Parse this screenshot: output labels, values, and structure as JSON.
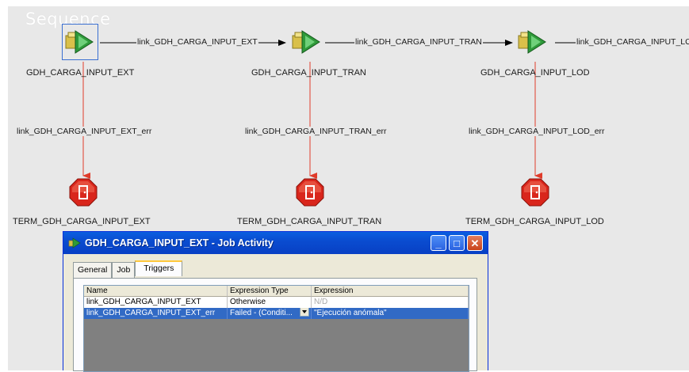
{
  "canvas": {
    "title": "Sequence"
  },
  "stages": [
    {
      "label": "GDH_CARGA_INPUT_EXT",
      "icon": "job-activity-icon",
      "selected": true
    },
    {
      "label": "GDH_CARGA_INPUT_TRAN",
      "icon": "job-activity-icon",
      "selected": false
    },
    {
      "label": "GDH_CARGA_INPUT_LOD",
      "icon": "job-activity-icon",
      "selected": false
    }
  ],
  "links": [
    "link_GDH_CARGA_INPUT_EXT",
    "link_GDH_CARGA_INPUT_TRAN",
    "link_GDH_CARGA_INPUT_LO"
  ],
  "error_links": [
    "link_GDH_CARGA_INPUT_EXT_err",
    "link_GDH_CARGA_INPUT_TRAN_err",
    "link_GDH_CARGA_INPUT_LOD_err"
  ],
  "terminators": [
    {
      "label": "TERM_GDH_CARGA_INPUT_EXT",
      "icon": "terminator-stop-icon"
    },
    {
      "label": "TERM_GDH_CARGA_INPUT_TRAN",
      "icon": "terminator-stop-icon"
    },
    {
      "label": "TERM_GDH_CARGA_INPUT_LOD",
      "icon": "terminator-stop-icon"
    }
  ],
  "dialog": {
    "title": "GDH_CARGA_INPUT_EXT - Job Activity",
    "buttons": {
      "minimize": "_",
      "maximize": "□",
      "close": "✕"
    },
    "tabs": [
      "General",
      "Job",
      "Triggers"
    ],
    "active_tab": "Triggers",
    "triggers_table": {
      "columns": [
        "Name",
        "Expression Type",
        "Expression"
      ],
      "rows": [
        {
          "name": "link_GDH_CARGA_INPUT_EXT",
          "type": "Otherwise",
          "expression": "N/D",
          "selected": false
        },
        {
          "name": "link_GDH_CARGA_INPUT_EXT_err",
          "type": "Failed - (Conditi...",
          "expression": "\"Ejecución anómala\"",
          "selected": true
        }
      ]
    }
  },
  "colors": {
    "canvas_bg": "#e8e8e8",
    "link_line": "#000000",
    "error_link": "#e03b2a",
    "selection": "#3a6fd1",
    "titlebar": "#0a4cd0",
    "row_selected": "#316ac5"
  }
}
